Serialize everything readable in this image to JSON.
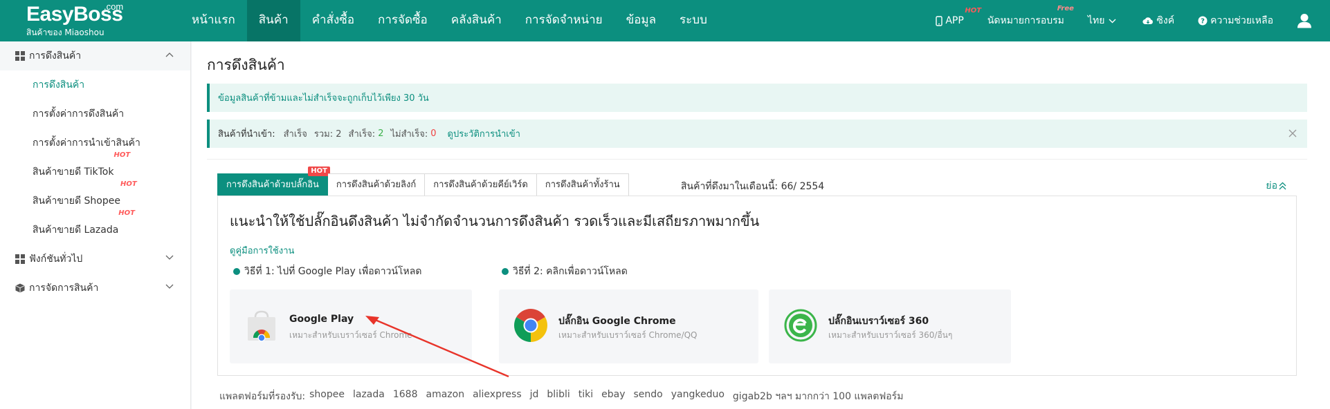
{
  "brand": {
    "name": "EasyBoss",
    "com": ".com",
    "subtitle": "สินค้าของ Miaoshou"
  },
  "nav": {
    "items": [
      {
        "label": "หน้าแรก"
      },
      {
        "label": "สินค้า"
      },
      {
        "label": "คำสั่งซื้อ"
      },
      {
        "label": "การจัดซื้อ"
      },
      {
        "label": "คลังสินค้า"
      },
      {
        "label": "การจัดจำหน่าย"
      },
      {
        "label": "ข้อมูล"
      },
      {
        "label": "ระบบ"
      }
    ],
    "active_index": 1,
    "right": {
      "app_label": "APP",
      "app_badge": "HOT",
      "training_label": "นัดหมายการอบรม",
      "training_badge": "Free",
      "language": "ไทย",
      "sync": "ซิงค์",
      "help": "ความช่วยเหลือ"
    }
  },
  "sidebar": {
    "groups": [
      {
        "label": "การดึงสินค้า",
        "icon": "grid-icon"
      },
      {
        "label": "ฟังก์ชันทั่วไป",
        "icon": "grid-icon"
      },
      {
        "label": "การจัดการสินค้า",
        "icon": "box-icon"
      }
    ],
    "items": [
      {
        "label": "การดึงสินค้า"
      },
      {
        "label": "การตั้งค่าการดึงสินค้า"
      },
      {
        "label": "การตั้งค่าการนำเข้าสินค้า"
      },
      {
        "label": "สินค้าขายดี TikTok",
        "badge": "HOT"
      },
      {
        "label": "สินค้าขายดี Shopee",
        "badge": "HOT"
      },
      {
        "label": "สินค้าขายดี Lazada",
        "badge": "HOT"
      }
    ]
  },
  "page": {
    "title": "การดึงสินค้า",
    "notice": "ข้อมูลสินค้าที่ข้ามและไม่สำเร็จจะถูกเก็บไว้เพียง 30 วัน",
    "import_status": {
      "label": "สินค้าที่นำเข้า:",
      "success_label": "สำเร็จ",
      "total": "รวม: 2",
      "ok_label": "สำเร็จ:",
      "ok_count": "2",
      "fail_label": "ไม่สำเร็จ:",
      "fail_count": "0",
      "history_link": "ดูประวัติการนำเข้า"
    },
    "tabs": [
      {
        "label": "การดึงสินค้าด้วยปลั๊กอิน",
        "badge": "HOT"
      },
      {
        "label": "การดึงสินค้าด้วยลิงก์"
      },
      {
        "label": "การดึงสินค้าด้วยคีย์เวิร์ด"
      },
      {
        "label": "การดึงสินค้าทั้งร้าน"
      }
    ],
    "month_label": "สินค้าที่ดึงมาในเดือนนี้:",
    "month_value": "66/ 2554",
    "collapse": "ย่อ",
    "headline": "แนะนำให้ใช้ปลั๊กอินดึงสินค้า ไม่จำกัดจำนวนการดึงสินค้า รวดเร็วและมีเสถียรภาพมากขึ้น",
    "guide_link": "ดูคู่มือการใช้งาน",
    "method1": "วิธีที่ 1: ไปที่ Google Play เพื่อดาวน์โหลด",
    "method2": "วิธีที่ 2: คลิกเพื่อดาวน์โหลด",
    "cards": [
      {
        "title": "Google Play",
        "sub": "เหมาะสำหรับเบราว์เซอร์ Chrome",
        "icon": "google-play-store-icon"
      },
      {
        "title": "ปลั๊กอิน Google Chrome",
        "sub": "เหมาะสำหรับเบราว์เซอร์ Chrome/QQ",
        "icon": "chrome-icon"
      },
      {
        "title": "ปลั๊กอินเบราว์เซอร์ 360",
        "sub": "เหมาะสำหรับเบราว์เซอร์ 360/อื่นๆ",
        "icon": "browser-360-icon"
      }
    ],
    "platforms_label": "แพลตฟอร์มที่รองรับ:",
    "platforms": [
      "shopee",
      "lazada",
      "1688",
      "amazon",
      "aliexpress",
      "jd",
      "blibli",
      "tiki",
      "ebay",
      "sendo",
      "yangkeduo",
      "gigab2b ฯลฯ มากกว่า 100 แพลตฟอร์ม"
    ]
  },
  "colors": {
    "brand": "#0c8f7f",
    "brand_dark": "#077466",
    "hot": "#f04848",
    "annotation_arrow": "#e8342a"
  }
}
